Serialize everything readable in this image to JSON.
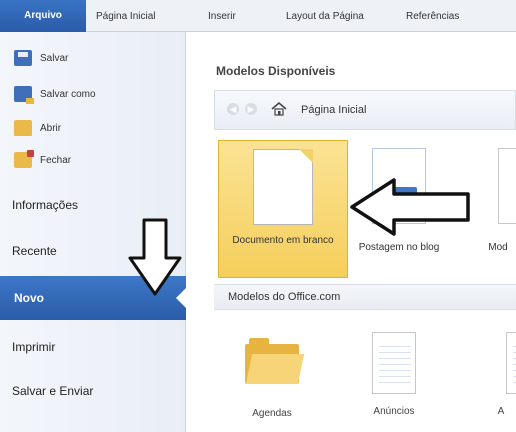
{
  "ribbon": {
    "file_tab": "Arquivo",
    "tabs": [
      "Página Inicial",
      "Inserir",
      "Layout da Página",
      "Referências"
    ]
  },
  "backstage": {
    "commands": [
      "Salvar",
      "Salvar como",
      "Abrir",
      "Fechar"
    ],
    "sections": [
      "Informações",
      "Recente",
      "Novo",
      "Imprimir",
      "Salvar e Enviar"
    ],
    "active_section": "Novo"
  },
  "main": {
    "available_title": "Modelos Disponíveis",
    "nav": {
      "home_label": "Página Inicial"
    },
    "templates": [
      {
        "label": "Documento em branco"
      },
      {
        "label": "Postagem no blog"
      },
      {
        "label": "Mod"
      }
    ],
    "office_label": "Modelos do Office.com",
    "office_items": [
      {
        "label": "Agendas"
      },
      {
        "label": "Anúncios"
      },
      {
        "label": "A"
      }
    ]
  },
  "colors": {
    "accent_blue": "#2a5ca8",
    "selected_yellow": "#f5cf5c"
  }
}
